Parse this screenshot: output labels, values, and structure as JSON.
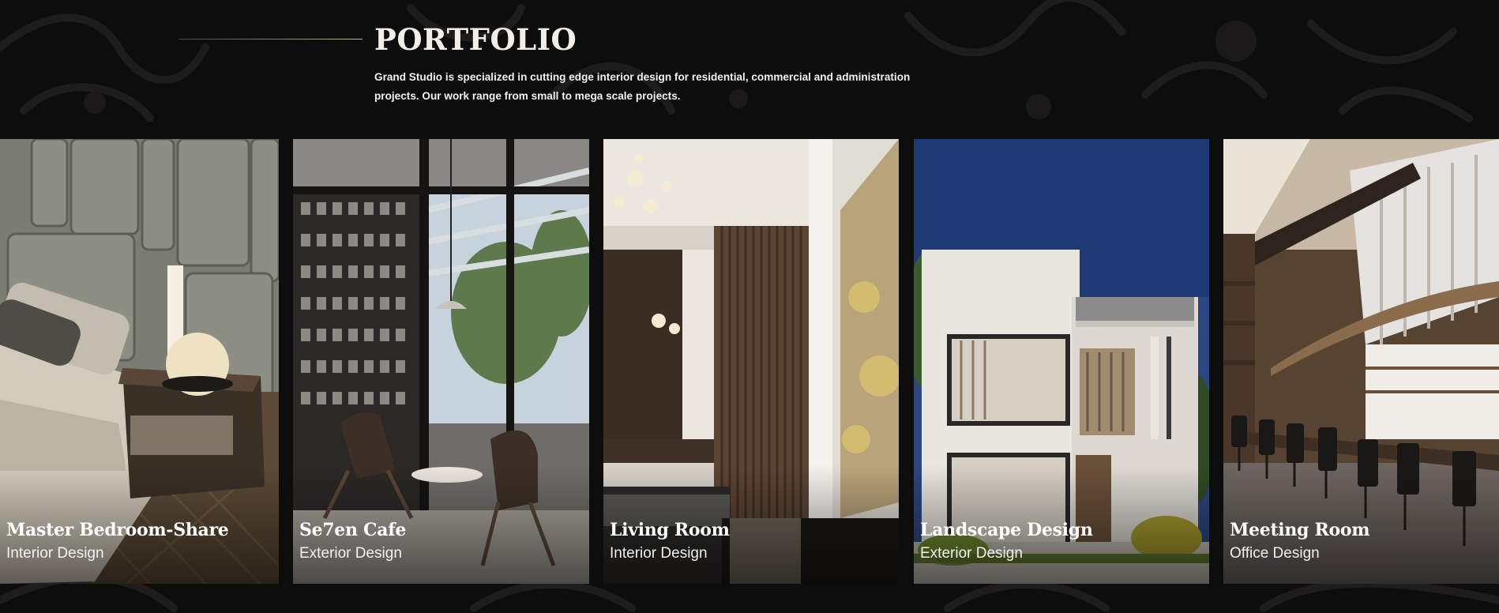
{
  "section": {
    "title": "PORTFOLIO",
    "intro": "Grand Studio is specialized in cutting edge interior design for residential, commercial and administration projects. Our work range from small to mega scale projects."
  },
  "colors": {
    "background": "#0e0d0d",
    "accent_rule": "#c9b393",
    "text": "#ffffff"
  },
  "projects": [
    {
      "title": "Master Bedroom-Share",
      "category": "Interior Design"
    },
    {
      "title": "Se7en Cafe",
      "category": "Exterior Design"
    },
    {
      "title": "Living Room",
      "category": "Interior Design"
    },
    {
      "title": "Landscape Design",
      "category": "Exterior Design"
    },
    {
      "title": "Meeting Room",
      "category": "Office Design"
    }
  ]
}
